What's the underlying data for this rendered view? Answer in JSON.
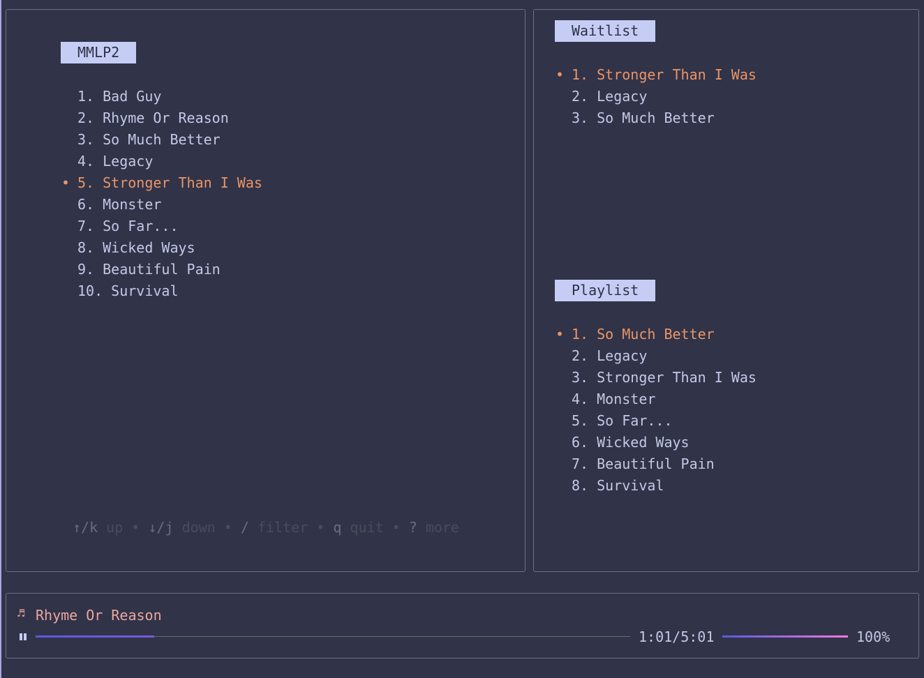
{
  "library": {
    "title": "MMLP2",
    "selected_index": 4,
    "items": [
      "1. Bad Guy",
      "2. Rhyme Or Reason",
      "3. So Much Better",
      "4. Legacy",
      "5. Stronger Than I Was",
      "6. Monster",
      "7. So Far...",
      "8. Wicked Ways",
      "9. Beautiful Pain",
      "10. Survival"
    ]
  },
  "help": [
    {
      "key": "↑/k",
      "desc": "up"
    },
    {
      "key": "↓/j",
      "desc": "down"
    },
    {
      "key": "/",
      "desc": "filter"
    },
    {
      "key": "q",
      "desc": "quit"
    },
    {
      "key": "?",
      "desc": "more"
    }
  ],
  "waitlist": {
    "title": "Waitlist",
    "selected_index": 0,
    "items": [
      "1. Stronger Than I Was",
      "2. Legacy",
      "3. So Much Better"
    ]
  },
  "playlist": {
    "title": "Playlist",
    "selected_index": 0,
    "items": [
      "1. So Much Better",
      "2. Legacy",
      "3. Stronger Than I Was",
      "4. Monster",
      "5. So Far...",
      "6. Wicked Ways",
      "7. Beautiful Pain",
      "8. Survival"
    ]
  },
  "player": {
    "now_playing": "Rhyme Or Reason",
    "icon": "music-note-icon",
    "state_icon": "pause-icon",
    "elapsed_time": "1:01/5:01",
    "progress": 0.2,
    "volume": "100%",
    "volume_fraction": 1.0,
    "accent": "#ea9566"
  }
}
